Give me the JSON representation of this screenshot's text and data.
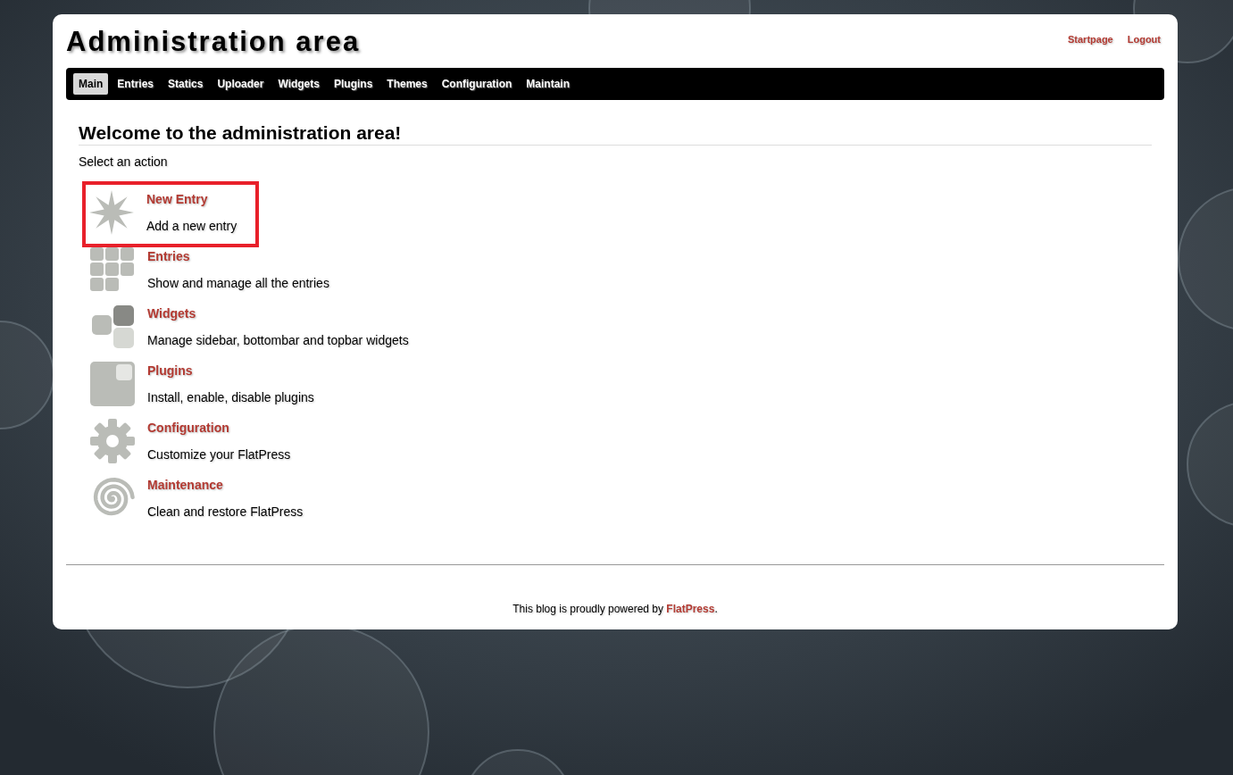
{
  "header": {
    "title": "Administration area",
    "links": [
      "Startpage",
      "Logout"
    ]
  },
  "tabs": [
    {
      "label": "Main",
      "selected": true
    },
    {
      "label": "Entries",
      "selected": false
    },
    {
      "label": "Statics",
      "selected": false
    },
    {
      "label": "Uploader",
      "selected": false
    },
    {
      "label": "Widgets",
      "selected": false
    },
    {
      "label": "Plugins",
      "selected": false
    },
    {
      "label": "Themes",
      "selected": false
    },
    {
      "label": "Configuration",
      "selected": false
    },
    {
      "label": "Maintain",
      "selected": false
    }
  ],
  "heading": "Welcome to the administration area!",
  "intro": "Select an action",
  "actions": [
    {
      "kind": "star",
      "title": "New Entry",
      "description": "Add a new entry",
      "highlighted": true
    },
    {
      "kind": "grid",
      "title": "Entries",
      "description": "Show and manage all the entries",
      "highlighted": false
    },
    {
      "kind": "blocks",
      "title": "Widgets",
      "description": "Manage sidebar, bottombar and topbar widgets",
      "highlighted": false
    },
    {
      "kind": "plugin",
      "title": "Plugins",
      "description": "Install, enable, disable plugins",
      "highlighted": false
    },
    {
      "kind": "gear",
      "title": "Configuration",
      "description": "Customize your FlatPress",
      "highlighted": false
    },
    {
      "kind": "spiral",
      "title": "Maintenance",
      "description": "Clean and restore FlatPress",
      "highlighted": false
    }
  ],
  "footer": {
    "before": "This blog is proudly powered by ",
    "link": "FlatPress",
    "after": "."
  }
}
